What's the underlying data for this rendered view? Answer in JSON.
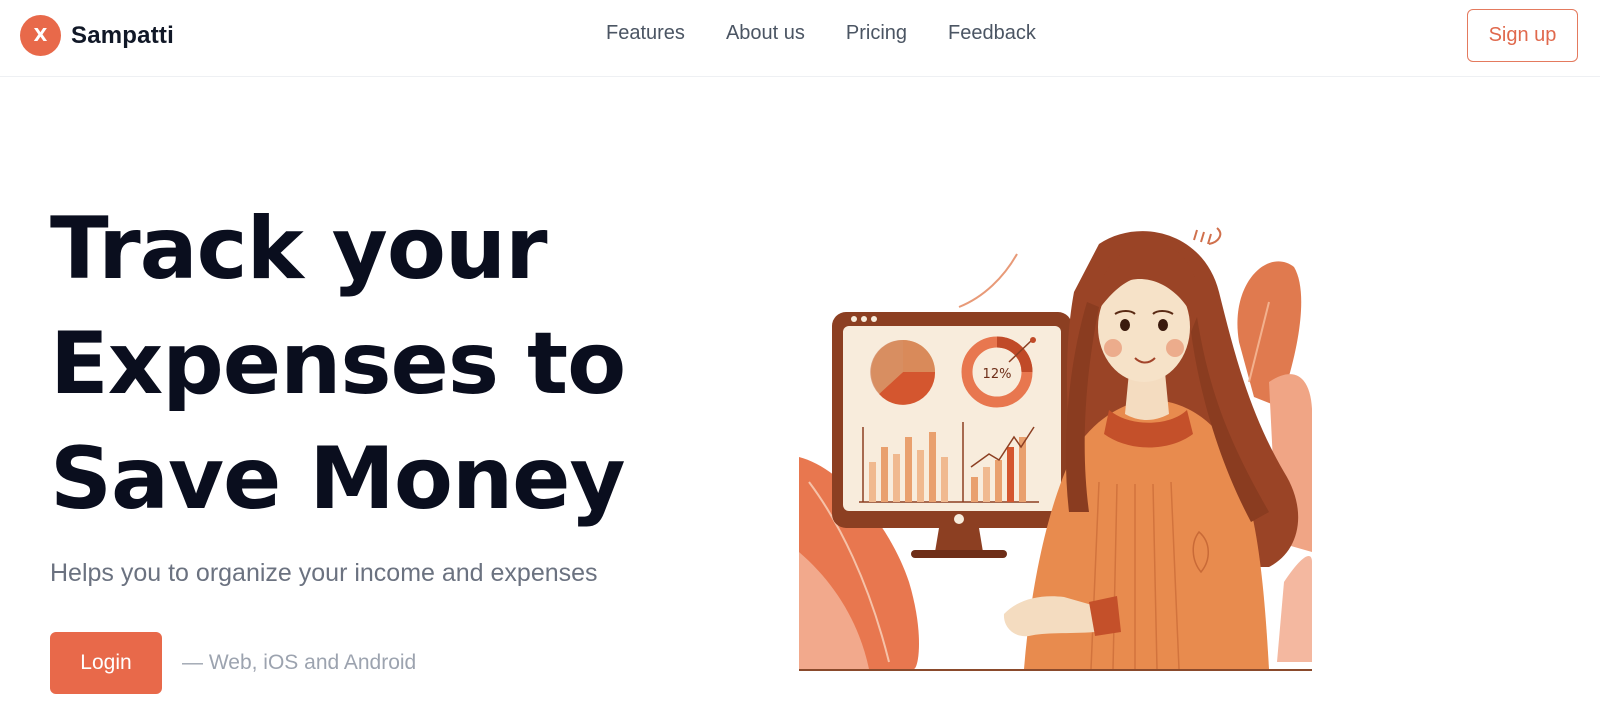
{
  "brand": {
    "logo_letter": "X",
    "name": "Sampatti",
    "accent": "#e8694a"
  },
  "nav": {
    "links": [
      "Features",
      "About us",
      "Pricing",
      "Feedback"
    ],
    "signup_label": "Sign up"
  },
  "hero": {
    "title_lines": [
      "Track your",
      "Expenses to",
      "Save Money"
    ],
    "subtitle": "Helps you to organize your income and expenses",
    "login_label": "Login",
    "platforms": "— Web, iOS and Android",
    "illustration": {
      "description_icon": "woman-with-finance-dashboard-illustration",
      "donut_label": "12%"
    }
  }
}
